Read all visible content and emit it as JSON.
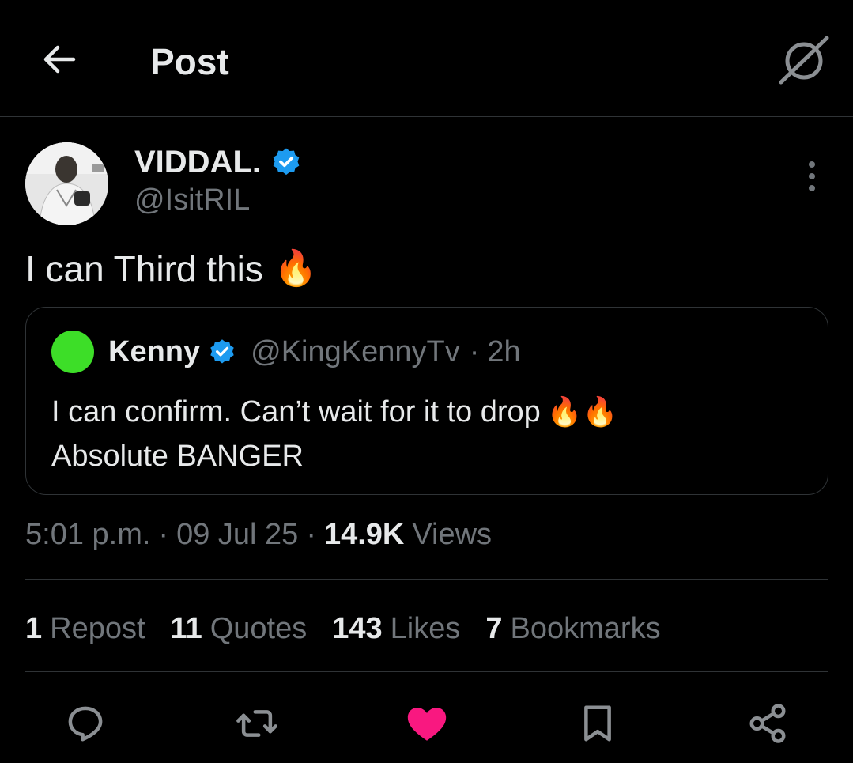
{
  "header": {
    "title": "Post",
    "back_icon": "arrow-left-icon",
    "grok_icon": "grok-icon"
  },
  "author": {
    "name": "VIDDAL.",
    "handle": "@IsitRIL",
    "verified": true
  },
  "post": {
    "text": "I can Third this",
    "emoji": "🔥"
  },
  "quote": {
    "name": "Kenny",
    "handle": "@KingKennyTv",
    "separator": "·",
    "time": "2h",
    "line1": "I can confirm. Can’t wait for it to drop",
    "line1_emoji": "🔥🔥",
    "line2": "Absolute BANGER",
    "avatar_color": "#3dde28"
  },
  "meta": {
    "time": "5:01 p.m.",
    "sep1": "·",
    "date": "09 Jul 25",
    "sep2": "·",
    "views_count": "14.9K",
    "views_label": "Views"
  },
  "stats": [
    {
      "count": "1",
      "label": "Repost"
    },
    {
      "count": "11",
      "label": "Quotes"
    },
    {
      "count": "143",
      "label": "Likes"
    },
    {
      "count": "7",
      "label": "Bookmarks"
    }
  ],
  "actions": {
    "reply_icon": "reply-icon",
    "repost_icon": "repost-icon",
    "like_icon": "heart-icon",
    "bookmark_icon": "bookmark-icon",
    "share_icon": "share-icon",
    "liked": true
  },
  "colors": {
    "background": "#000000",
    "text": "#e7e9ea",
    "secondary": "#71767b",
    "divider": "#2f3336",
    "verified": "#1d9bf0",
    "like": "#f91880"
  }
}
